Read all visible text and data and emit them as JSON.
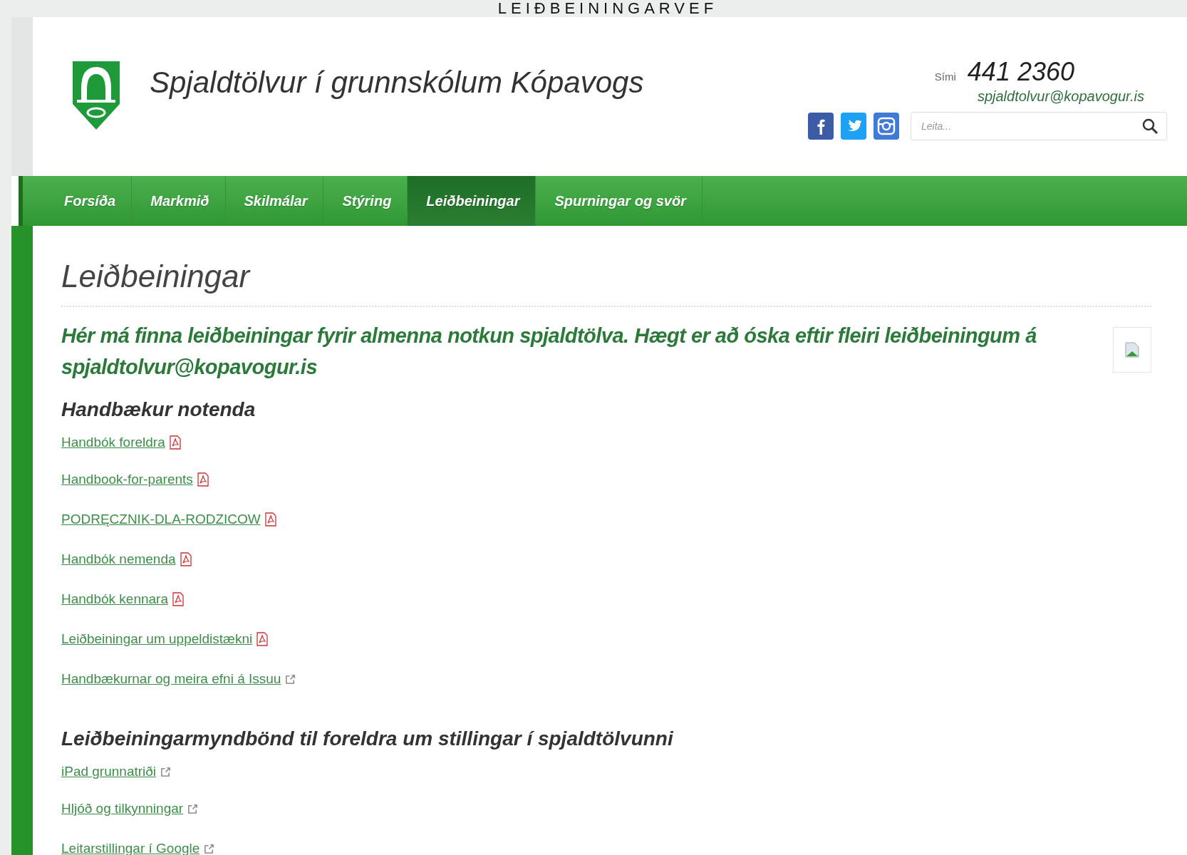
{
  "slide_title": "LEIÐBEININGARVEF",
  "site": {
    "title": "Spjaldtölvur í grunnskólum Kópavogs",
    "phone_label": "Sími",
    "phone": "441 2360",
    "email": "spjaldtolvur@kopavogur.is",
    "search": {
      "placeholder": "Leita..."
    }
  },
  "nav": [
    {
      "label": "Forsíða",
      "selected": false
    },
    {
      "label": "Markmið",
      "selected": false
    },
    {
      "label": "Skilmálar",
      "selected": false
    },
    {
      "label": "Stýring",
      "selected": false
    },
    {
      "label": "Leiðbeiningar",
      "selected": true
    },
    {
      "label": "Spurningar og svör",
      "selected": false
    }
  ],
  "page": {
    "heading": "Leiðbeiningar",
    "intro": "Hér má finna leiðbeiningar fyrir almenna notkun spjaldtölva. Hægt er að óska eftir fleiri leiðbeiningum á spjaldtolvur@kopavogur.is",
    "sections": [
      {
        "heading": "Handbækur notenda",
        "links": [
          {
            "label": "Handbók foreldra",
            "kind": "pdf"
          },
          {
            "label": "Handbook-for-parents",
            "kind": "pdf"
          },
          {
            "label": "PODRĘCZNIK-DLA-RODZICOW",
            "kind": "pdf"
          },
          {
            "label": "Handbók nemenda",
            "kind": "pdf"
          },
          {
            "label": "Handbók kennara",
            "kind": "pdf"
          },
          {
            "label": "Leiðbeiningar um uppeldistækni",
            "kind": "pdf"
          },
          {
            "label": "Handbækurnar og meira efni á Issuu",
            "kind": "external"
          }
        ]
      },
      {
        "heading": "Leiðbeiningarmyndbönd til foreldra um stillingar í spjaldtölvunni",
        "links": [
          {
            "label": "iPad grunnatriði",
            "kind": "external"
          },
          {
            "label": "Hljóð og tilkynningar",
            "kind": "external"
          },
          {
            "label": "Leitarstillingar í Google",
            "kind": "external"
          }
        ]
      }
    ]
  }
}
